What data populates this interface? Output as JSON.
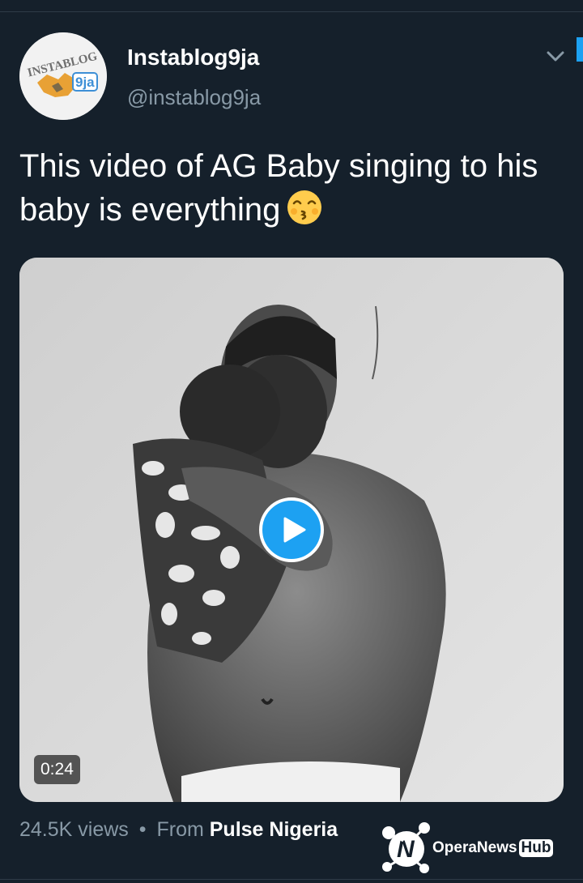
{
  "tweet": {
    "display_name": "Instablog9ja",
    "handle": "@instablog9ja",
    "text": "This video of AG Baby singing to his baby is everything",
    "emoji": "kissing-face-with-smiling-eyes-icon",
    "avatar_logo": "INSTABLOG 9ja"
  },
  "video": {
    "duration": "0:24"
  },
  "meta": {
    "views": "24.5K views",
    "separator": "•",
    "from_label": "From",
    "source": "Pulse Nigeria"
  },
  "watermark": {
    "brand": "OperaNews",
    "hub": "Hub"
  },
  "colors": {
    "background": "#15202b",
    "accent": "#1da1f2",
    "secondary_text": "#8899a6"
  }
}
